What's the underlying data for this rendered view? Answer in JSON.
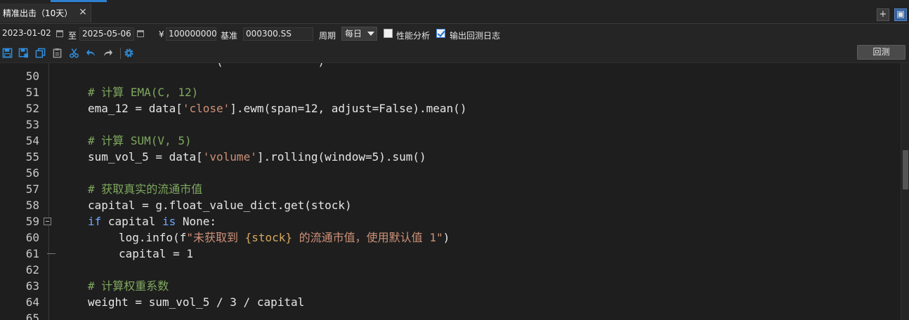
{
  "tab": {
    "label": "精准出击（10天）",
    "close": "×"
  },
  "window": {
    "add": "+",
    "restore": "▣"
  },
  "params": {
    "start_date": "2023-01-02",
    "to_label": "至",
    "end_date": "2025-05-06",
    "currency": "¥",
    "capital": "100000000",
    "benchmark_label": "基准",
    "benchmark": "000300.SS",
    "period_label": "周期",
    "period_value": "每日",
    "perf_label": "性能分析",
    "perf_checked": false,
    "log_label": "输出回测日志",
    "log_checked": true
  },
  "toolbar": {
    "icons": [
      "save-icon",
      "save-as-icon",
      "copy-icon",
      "paste-icon",
      "cut-icon",
      "undo-icon",
      "redo-icon",
      "settings-icon"
    ],
    "run_label": "回测",
    "accent": "#2f8fe0"
  },
  "editor": {
    "lines": [
      {
        "num": "50",
        "segments": []
      },
      {
        "num": "51",
        "segments": [
          {
            "t": "# 计算 EMA(C, 12)",
            "c": "cmt"
          }
        ]
      },
      {
        "num": "52",
        "segments": [
          {
            "t": "ema_12 = data["
          },
          {
            "t": "'close'",
            "c": "str"
          },
          {
            "t": "].ewm(span=12, adjust=False).mean()"
          }
        ]
      },
      {
        "num": "53",
        "segments": []
      },
      {
        "num": "54",
        "segments": [
          {
            "t": "# 计算 SUM(V, 5)",
            "c": "cmt"
          }
        ]
      },
      {
        "num": "55",
        "segments": [
          {
            "t": "sum_vol_5 = data["
          },
          {
            "t": "'volume'",
            "c": "str"
          },
          {
            "t": "].rolling(window=5).sum()"
          }
        ]
      },
      {
        "num": "56",
        "segments": []
      },
      {
        "num": "57",
        "segments": [
          {
            "t": "# 获取真实的流通市值",
            "c": "cmt"
          }
        ]
      },
      {
        "num": "58",
        "segments": [
          {
            "t": "capital = g.float_value_dict.get(stock)"
          }
        ]
      },
      {
        "num": "59",
        "segments": [
          {
            "t": "if",
            "c": "kw"
          },
          {
            "t": " capital "
          },
          {
            "t": "is",
            "c": "kw"
          },
          {
            "t": " None:"
          }
        ]
      },
      {
        "num": "60",
        "indent": 1,
        "segments": [
          {
            "t": "log.info(f"
          },
          {
            "t": "\"未获取到 ",
            "c": "str"
          },
          {
            "t": "{stock}",
            "c": "tpl"
          },
          {
            "t": " 的流通市值，使用默认值 1\"",
            "c": "str"
          },
          {
            "t": ")"
          }
        ]
      },
      {
        "num": "61",
        "indent": 1,
        "segments": [
          {
            "t": "capital = 1"
          }
        ]
      },
      {
        "num": "62",
        "segments": []
      },
      {
        "num": "63",
        "segments": [
          {
            "t": "# 计算权重系数",
            "c": "cmt"
          }
        ]
      },
      {
        "num": "64",
        "segments": [
          {
            "t": "weight = sum_vol_5 / 3 / capital"
          }
        ]
      },
      {
        "num": "65",
        "segments": []
      }
    ],
    "colors": {
      "comment": "#7fa85f",
      "string": "#ce9178",
      "keyword": "#6fa8ff",
      "template": "#d7a960",
      "text": "#e6e6e6"
    }
  }
}
